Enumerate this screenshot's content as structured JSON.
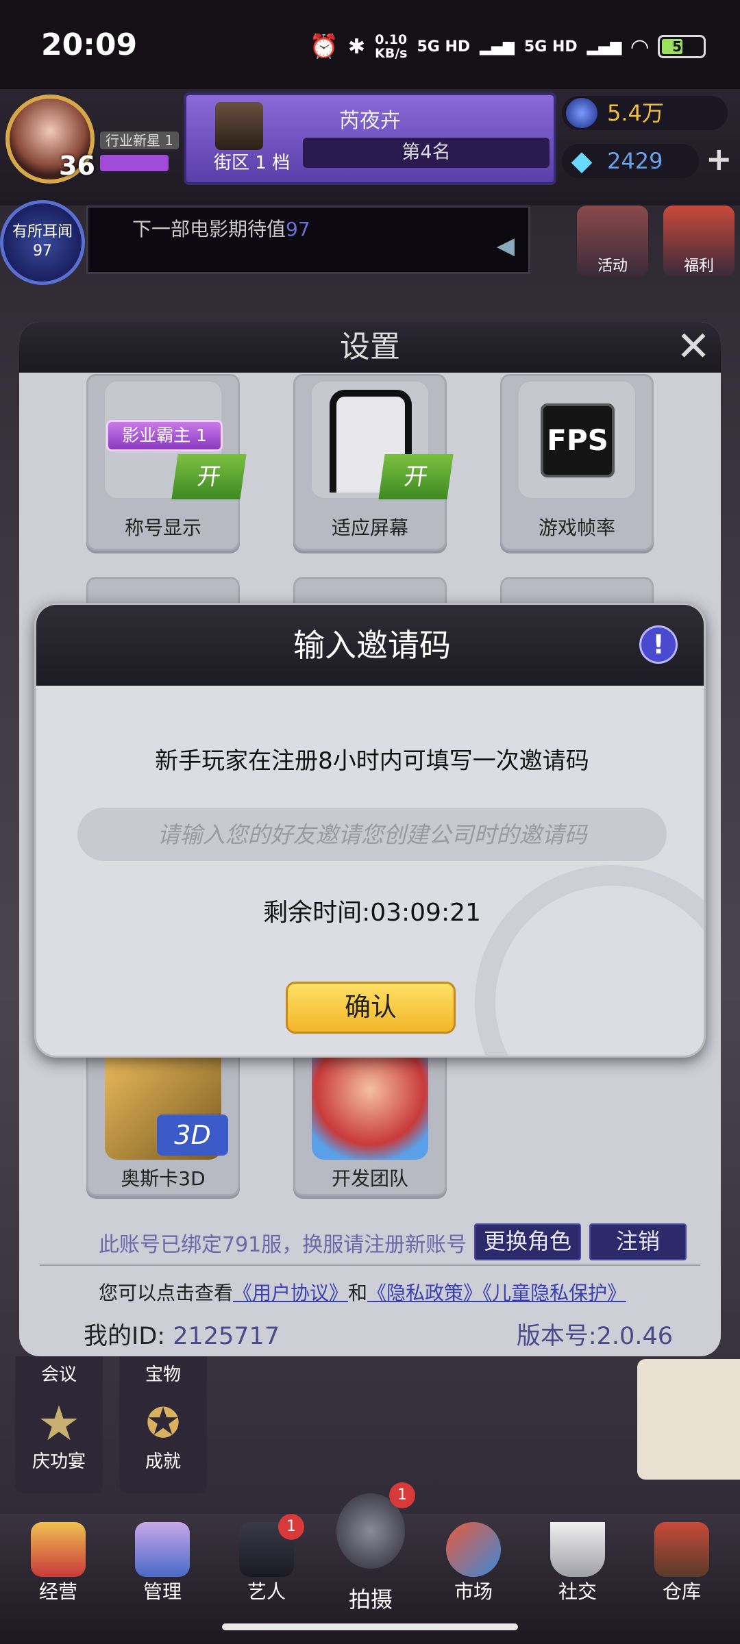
{
  "status_bar": {
    "time": "20:09",
    "net_speed_value": "0.10",
    "net_speed_unit": "KB/s",
    "signal1": "5G HD",
    "signal2": "5G HD",
    "battery": "51"
  },
  "hud": {
    "level": "36",
    "rank_tag": "行业新星 1",
    "district_name": "芮夜卉",
    "district_level": "街区 1 档",
    "district_rank": "第4名",
    "money": "5.4万",
    "diamonds": "2429",
    "plus": "+"
  },
  "ticker": {
    "ear_label": "有所耳闻",
    "ear_value": "97",
    "text": "下一部电影期待值",
    "value": "97"
  },
  "side_buttons": {
    "activity": "活动",
    "welfare": "福利"
  },
  "settings": {
    "title": "设置",
    "close": "✕",
    "tiles": [
      {
        "label": "称号显示",
        "badge": "影业霸主 1",
        "toggle": "开"
      },
      {
        "label": "适应屏幕",
        "toggle": "开"
      },
      {
        "label": "游戏帧率",
        "icon_text": "FPS"
      },
      {
        "label": "奥斯卡3D",
        "icon_text": "3D"
      },
      {
        "label": "开发团队"
      }
    ],
    "bind_notice": "此账号已绑定791服，换服请注册新账号",
    "switch_role": "更换角色",
    "logout": "注销",
    "agree_prefix": "您可以点击查看",
    "user_agreement": "《用户协议》",
    "and": "和",
    "privacy_policy": "《隐私政策》",
    "child_privacy": "《儿童隐私保护》",
    "my_id_label": "我的ID:",
    "my_id_value": "2125717",
    "version": "版本号:2.0.46"
  },
  "invite_dialog": {
    "title": "输入邀请码",
    "info_icon": "!",
    "message": "新手玩家在注册8小时内可填写一次邀请码",
    "placeholder": "请输入您的好友邀请您创建公司时的邀请码",
    "countdown": "剩余时间:03:09:21",
    "confirm": "确认"
  },
  "left_stack": {
    "meeting": "会议",
    "treasure": "宝物",
    "celebration": "庆功宴",
    "achievement": "成就"
  },
  "bottom_nav": [
    {
      "label": "经营"
    },
    {
      "label": "管理"
    },
    {
      "label": "艺人",
      "badge": "1"
    },
    {
      "label": "拍摄",
      "badge": "1"
    },
    {
      "label": "市场"
    },
    {
      "label": "社交"
    },
    {
      "label": "仓库"
    }
  ],
  "colors": {
    "accent_purple": "#7a5ac8",
    "confirm_yellow": "#f2b52a",
    "link_blue": "#3a40b0",
    "badge_red": "#d83a3a"
  }
}
